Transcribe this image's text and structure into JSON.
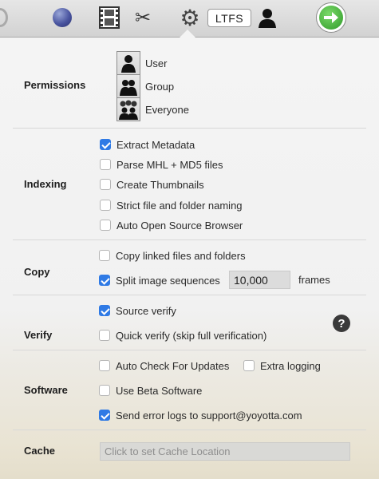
{
  "toolbar": {
    "ltfs_label": "LTFS",
    "icons": [
      "loading-spinner-icon",
      "globe-icon",
      "film-icon",
      "scissors-icon",
      "gear-icon",
      "user-icon",
      "go-arrow-icon"
    ]
  },
  "sections": {
    "permissions": {
      "label": "Permissions",
      "options": [
        {
          "label": "User",
          "icon": "user-icon"
        },
        {
          "label": "Group",
          "icon": "group-icon"
        },
        {
          "label": "Everyone",
          "icon": "everyone-icon"
        }
      ]
    },
    "indexing": {
      "label": "Indexing",
      "options": [
        {
          "label": "Extract Metadata",
          "checked": true
        },
        {
          "label": "Parse MHL + MD5 files",
          "checked": false
        },
        {
          "label": "Create Thumbnails",
          "checked": false
        },
        {
          "label": "Strict file and folder naming",
          "checked": false
        },
        {
          "label": "Auto Open Source Browser",
          "checked": false
        }
      ]
    },
    "copy": {
      "label": "Copy",
      "copy_linked": {
        "label": "Copy linked files and folders",
        "checked": false
      },
      "split_sequences": {
        "label": "Split image sequences",
        "checked": true,
        "value": "10,000",
        "unit": "frames"
      }
    },
    "verify": {
      "label": "Verify",
      "options": [
        {
          "label": "Source verify",
          "checked": true
        },
        {
          "label": "Quick verify (skip full verification)",
          "checked": false
        }
      ],
      "help_label": "?"
    },
    "software": {
      "label": "Software",
      "auto_check": {
        "label": "Auto Check For Updates",
        "checked": false
      },
      "extra_logging": {
        "label": "Extra logging",
        "checked": false
      },
      "beta": {
        "label": "Use Beta Software",
        "checked": false
      },
      "send_logs": {
        "label": "Send error logs to support@yoyotta.com",
        "checked": true
      }
    },
    "cache": {
      "label": "Cache",
      "placeholder": "Click to set Cache Location"
    }
  },
  "colors": {
    "accent": "#2f7ae5",
    "go_button": "#2f9a28"
  }
}
